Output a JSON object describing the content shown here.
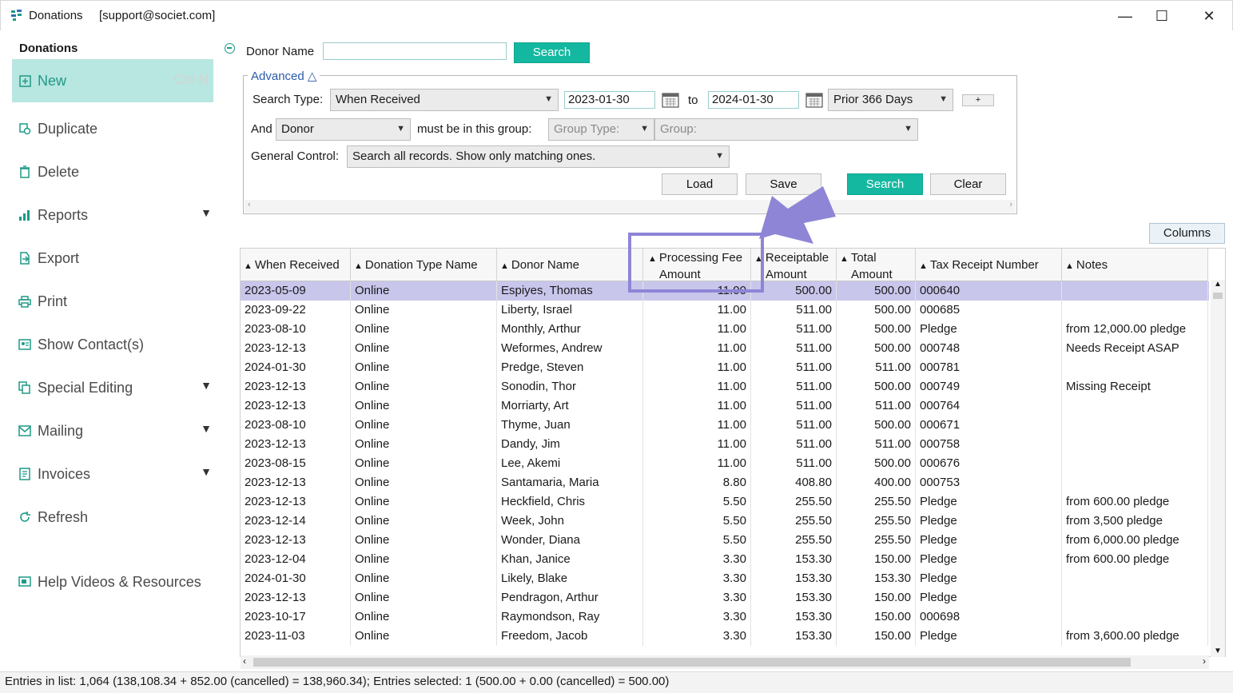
{
  "window": {
    "title": "Donations",
    "account": "[support@societ.com]",
    "minimize": "—",
    "maximize": "☐",
    "close": "✕"
  },
  "sidebar": {
    "heading": "Donations",
    "new_label": "New",
    "new_shortcut": "Ctrl N",
    "items": [
      {
        "label": "Duplicate",
        "icon": "duplicate-icon"
      },
      {
        "label": "Delete",
        "icon": "trash-icon"
      },
      {
        "label": "Reports",
        "icon": "bar-chart-icon"
      },
      {
        "label": "Export",
        "icon": "export-icon"
      },
      {
        "label": "Print",
        "icon": "printer-icon"
      },
      {
        "label": "Show Contact(s)",
        "icon": "contact-card-icon"
      },
      {
        "label": "Special Editing",
        "icon": "edit-copy-icon"
      },
      {
        "label": "Mailing",
        "icon": "mail-icon"
      },
      {
        "label": "Invoices",
        "icon": "invoice-icon"
      },
      {
        "label": "Refresh",
        "icon": "refresh-icon"
      },
      {
        "label": "Help Videos & Resources",
        "icon": "video-icon"
      }
    ]
  },
  "search": {
    "donor_name_label": "Donor Name",
    "donor_name_value": "",
    "search_button": "Search",
    "advanced_label": "Advanced △",
    "search_type_label": "Search Type:",
    "search_type_value": "When Received",
    "date_from": "2023-01-30",
    "to_label": "to",
    "date_to": "2024-01-30",
    "range_value": "Prior 366 Days",
    "plus_button": "+",
    "and_label": "And",
    "and_value": "Donor",
    "group_label": "must be in this group:",
    "group_type_placeholder": "Group Type:",
    "group_placeholder": "Group:",
    "general_control_label": "General Control:",
    "general_control_value": "Search all records. Show only matching ones.",
    "load_button": "Load",
    "save_button": "Save",
    "search_button_2": "Search",
    "clear_button": "Clear"
  },
  "table": {
    "columns_button": "Columns",
    "headers": {
      "when_received": "When Received",
      "donation_type": "Donation Type Name",
      "donor_name": "Donor Name",
      "fee_1": "Processing Fee",
      "fee_2": "Amount",
      "receipt_1": "Receiptable",
      "receipt_2": "Amount",
      "total_1": "Total",
      "total_2": "Amount",
      "tax_receipt": "Tax Receipt Number",
      "notes": "Notes"
    },
    "rows": [
      [
        "2023-05-09",
        "Online",
        "Espiyes, Thomas",
        "11.00",
        "500.00",
        "500.00",
        "000640",
        ""
      ],
      [
        "2023-09-22",
        "Online",
        "Liberty, Israel",
        "11.00",
        "511.00",
        "500.00",
        "000685",
        ""
      ],
      [
        "2023-08-10",
        "Online",
        "Monthly, Arthur",
        "11.00",
        "511.00",
        "500.00",
        "Pledge",
        "from 12,000.00 pledge"
      ],
      [
        "2023-12-13",
        "Online",
        "Weformes, Andrew",
        "11.00",
        "511.00",
        "500.00",
        "000748",
        "Needs Receipt ASAP"
      ],
      [
        "2024-01-30",
        "Online",
        "Predge, Steven",
        "11.00",
        "511.00",
        "511.00",
        "000781",
        ""
      ],
      [
        "2023-12-13",
        "Online",
        "Sonodin, Thor",
        "11.00",
        "511.00",
        "500.00",
        "000749",
        "Missing Receipt"
      ],
      [
        "2023-12-13",
        "Online",
        "Morriarty, Art",
        "11.00",
        "511.00",
        "511.00",
        "000764",
        ""
      ],
      [
        "2023-08-10",
        "Online",
        "Thyme, Juan",
        "11.00",
        "511.00",
        "500.00",
        "000671",
        ""
      ],
      [
        "2023-12-13",
        "Online",
        "Dandy, Jim",
        "11.00",
        "511.00",
        "511.00",
        "000758",
        ""
      ],
      [
        "2023-08-15",
        "Online",
        "Lee, Akemi",
        "11.00",
        "511.00",
        "500.00",
        "000676",
        ""
      ],
      [
        "2023-12-13",
        "Online",
        "Santamaria, Maria",
        "8.80",
        "408.80",
        "400.00",
        "000753",
        ""
      ],
      [
        "2023-12-13",
        "Online",
        "Heckfield, Chris",
        "5.50",
        "255.50",
        "255.50",
        "Pledge",
        "from 600.00 pledge"
      ],
      [
        "2023-12-14",
        "Online",
        "Week, John",
        "5.50",
        "255.50",
        "255.50",
        "Pledge",
        "from 3,500 pledge"
      ],
      [
        "2023-12-13",
        "Online",
        "Wonder, Diana",
        "5.50",
        "255.50",
        "255.50",
        "Pledge",
        "from 6,000.00 pledge"
      ],
      [
        "2023-12-04",
        "Online",
        "Khan, Janice",
        "3.30",
        "153.30",
        "150.00",
        "Pledge",
        "from 600.00 pledge"
      ],
      [
        "2024-01-30",
        "Online",
        "Likely, Blake",
        "3.30",
        "153.30",
        "153.30",
        "Pledge",
        ""
      ],
      [
        "2023-12-13",
        "Online",
        "Pendragon, Arthur",
        "3.30",
        "153.30",
        "150.00",
        "Pledge",
        ""
      ],
      [
        "2023-10-17",
        "Online",
        "Raymondson, Ray",
        "3.30",
        "153.30",
        "150.00",
        "000698",
        ""
      ],
      [
        "2023-11-03",
        "Online",
        "Freedom, Jacob",
        "3.30",
        "153.30",
        "150.00",
        "Pledge",
        "from 3,600.00 pledge"
      ]
    ],
    "selected_row": 0
  },
  "status": {
    "text": "Entries in list: 1,064 (138,108.34 + 852.00 (cancelled) = 138,960.34); Entries selected: 1 (500.00 + 0.00 (cancelled) = 500.00)"
  },
  "colors": {
    "accent": "#14b8a0",
    "selected_row": "#c9c6ec",
    "annotation": "#8e85d6"
  }
}
